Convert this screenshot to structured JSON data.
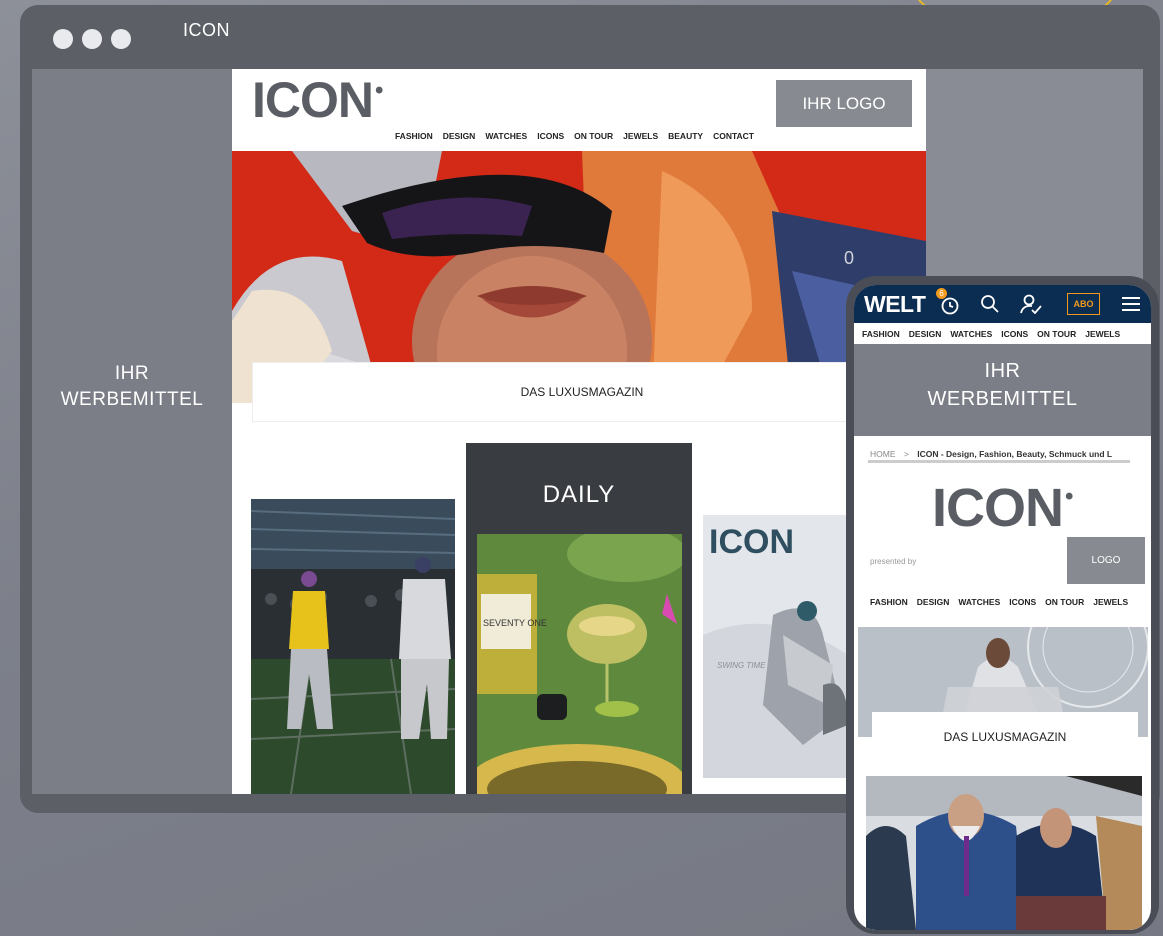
{
  "window": {
    "title": "ICON"
  },
  "desktop": {
    "ad_label": "IHR\nWERBEMITTEL",
    "logo": "ICON",
    "logo_placeholder": "IHR LOGO",
    "nav": [
      "FASHION",
      "DESIGN",
      "WATCHES",
      "ICONS",
      "ON TOUR",
      "JEWELS",
      "BEAUTY",
      "CONTACT"
    ],
    "tagline": "DAS LUXUSMAGAZIN",
    "daily_label": "DAILY",
    "bottle_text": "SEVENTY ONE",
    "cover_logo": "ICON",
    "cover_text": "SWING TIME"
  },
  "mobile": {
    "brand": "WELT",
    "badge_count": "6",
    "abo_label": "ABO",
    "nav": [
      "FASHION",
      "DESIGN",
      "WATCHES",
      "ICONS",
      "ON TOUR",
      "JEWELS"
    ],
    "ad_label": "IHR\nWERBEMITTEL",
    "breadcrumb_home": "HOME",
    "breadcrumb_sep": ">",
    "breadcrumb_current": "ICON - Design, Fashion, Beauty, Schmuck und L",
    "logo": "ICON",
    "presented_by": "presented by",
    "logo_placeholder": "LOGO",
    "nav2": [
      "FASHION",
      "DESIGN",
      "WATCHES",
      "ICONS",
      "ON TOUR",
      "JEWELS"
    ],
    "tagline": "DAS LUXUSMAGAZIN"
  }
}
